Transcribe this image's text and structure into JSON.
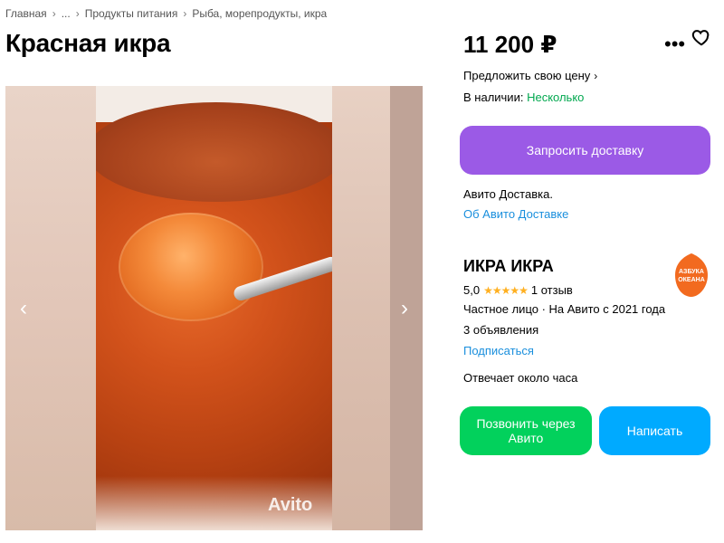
{
  "breadcrumb": {
    "items": [
      "Главная",
      "...",
      "Продукты питания",
      "Рыба, морепродукты, икра"
    ]
  },
  "title": "Красная икра",
  "gallery": {
    "watermark": "Avito",
    "prev_icon": "chevron-left-icon",
    "next_icon": "chevron-right-icon"
  },
  "price": "11 200 ₽",
  "actions": {
    "more_icon": "more-horizontal-icon",
    "favorite_icon": "heart-icon"
  },
  "offer_price": "Предложить свою цену",
  "stock": {
    "label": "В наличии:",
    "value": "Несколько"
  },
  "delivery": {
    "button_label": "Запросить доставку",
    "text": "Авито Доставка.",
    "link": "Об Авито Доставке"
  },
  "seller": {
    "name": "ИКРА ИКРА",
    "logo_text": "Азбука Океана",
    "rating": "5,0",
    "stars": "★★★★★",
    "reviews": "1 отзыв",
    "type": "Частное лицо · На Авито с 2021 года",
    "ads": "3 объявления",
    "subscribe": "Подписаться",
    "response_time": "Отвечает около часа"
  },
  "contact": {
    "call_label": "Позвонить через Авито",
    "write_label": "Написать"
  },
  "colors": {
    "purple": "#9b5ae6",
    "green_button": "#02d15c",
    "blue_button": "#00aaff",
    "link": "#1a8fdd",
    "stock_green": "#02a84f",
    "stars": "#ffb021"
  }
}
